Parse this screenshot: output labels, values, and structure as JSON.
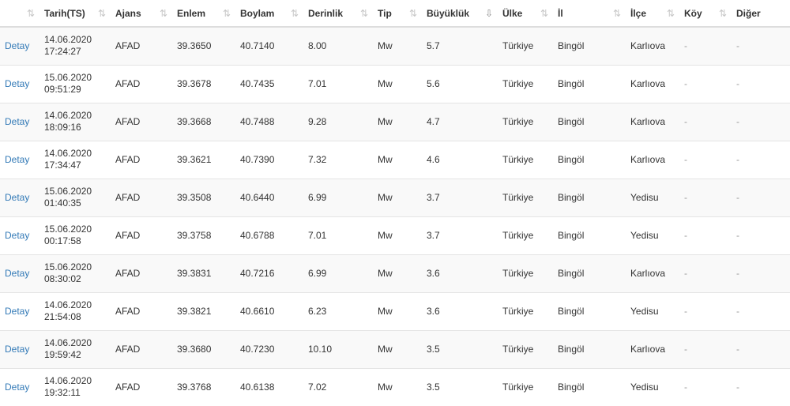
{
  "headers": {
    "actions": "",
    "date": "Tarih(TS)",
    "agency": "Ajans",
    "lat": "Enlem",
    "lon": "Boylam",
    "depth": "Derinlik",
    "type": "Tip",
    "magnitude": "Büyüklük",
    "country": "Ülke",
    "province": "İl",
    "district": "İlçe",
    "village": "Köy",
    "other": "Diğer"
  },
  "icons": {
    "sort": "sort-both-icon",
    "sort_desc": "sort-desc-icon"
  },
  "rows": [
    {
      "detail": "Detay",
      "date": "14.06.2020",
      "time": "17:24:27",
      "agency": "AFAD",
      "lat": "39.3650",
      "lon": "40.7140",
      "depth": "8.00",
      "type": "Mw",
      "magnitude": "5.7",
      "country": "Türkiye",
      "province": "Bingöl",
      "district": "Karlıova",
      "village": "-",
      "other": "-"
    },
    {
      "detail": "Detay",
      "date": "15.06.2020",
      "time": "09:51:29",
      "agency": "AFAD",
      "lat": "39.3678",
      "lon": "40.7435",
      "depth": "7.01",
      "type": "Mw",
      "magnitude": "5.6",
      "country": "Türkiye",
      "province": "Bingöl",
      "district": "Karlıova",
      "village": "-",
      "other": "-"
    },
    {
      "detail": "Detay",
      "date": "14.06.2020",
      "time": "18:09:16",
      "agency": "AFAD",
      "lat": "39.3668",
      "lon": "40.7488",
      "depth": "9.28",
      "type": "Mw",
      "magnitude": "4.7",
      "country": "Türkiye",
      "province": "Bingöl",
      "district": "Karlıova",
      "village": "-",
      "other": "-"
    },
    {
      "detail": "Detay",
      "date": "14.06.2020",
      "time": "17:34:47",
      "agency": "AFAD",
      "lat": "39.3621",
      "lon": "40.7390",
      "depth": "7.32",
      "type": "Mw",
      "magnitude": "4.6",
      "country": "Türkiye",
      "province": "Bingöl",
      "district": "Karlıova",
      "village": "-",
      "other": "-"
    },
    {
      "detail": "Detay",
      "date": "15.06.2020",
      "time": "01:40:35",
      "agency": "AFAD",
      "lat": "39.3508",
      "lon": "40.6440",
      "depth": "6.99",
      "type": "Mw",
      "magnitude": "3.7",
      "country": "Türkiye",
      "province": "Bingöl",
      "district": "Yedisu",
      "village": "-",
      "other": "-"
    },
    {
      "detail": "Detay",
      "date": "15.06.2020",
      "time": "00:17:58",
      "agency": "AFAD",
      "lat": "39.3758",
      "lon": "40.6788",
      "depth": "7.01",
      "type": "Mw",
      "magnitude": "3.7",
      "country": "Türkiye",
      "province": "Bingöl",
      "district": "Yedisu",
      "village": "-",
      "other": "-"
    },
    {
      "detail": "Detay",
      "date": "15.06.2020",
      "time": "08:30:02",
      "agency": "AFAD",
      "lat": "39.3831",
      "lon": "40.7216",
      "depth": "6.99",
      "type": "Mw",
      "magnitude": "3.6",
      "country": "Türkiye",
      "province": "Bingöl",
      "district": "Karlıova",
      "village": "-",
      "other": "-"
    },
    {
      "detail": "Detay",
      "date": "14.06.2020",
      "time": "21:54:08",
      "agency": "AFAD",
      "lat": "39.3821",
      "lon": "40.6610",
      "depth": "6.23",
      "type": "Mw",
      "magnitude": "3.6",
      "country": "Türkiye",
      "province": "Bingöl",
      "district": "Yedisu",
      "village": "-",
      "other": "-"
    },
    {
      "detail": "Detay",
      "date": "14.06.2020",
      "time": "19:59:42",
      "agency": "AFAD",
      "lat": "39.3680",
      "lon": "40.7230",
      "depth": "10.10",
      "type": "Mw",
      "magnitude": "3.5",
      "country": "Türkiye",
      "province": "Bingöl",
      "district": "Karlıova",
      "village": "-",
      "other": "-"
    },
    {
      "detail": "Detay",
      "date": "14.06.2020",
      "time": "19:32:11",
      "agency": "AFAD",
      "lat": "39.3768",
      "lon": "40.6138",
      "depth": "7.02",
      "type": "Mw",
      "magnitude": "3.5",
      "country": "Türkiye",
      "province": "Bingöl",
      "district": "Yedisu",
      "village": "-",
      "other": "-"
    }
  ]
}
